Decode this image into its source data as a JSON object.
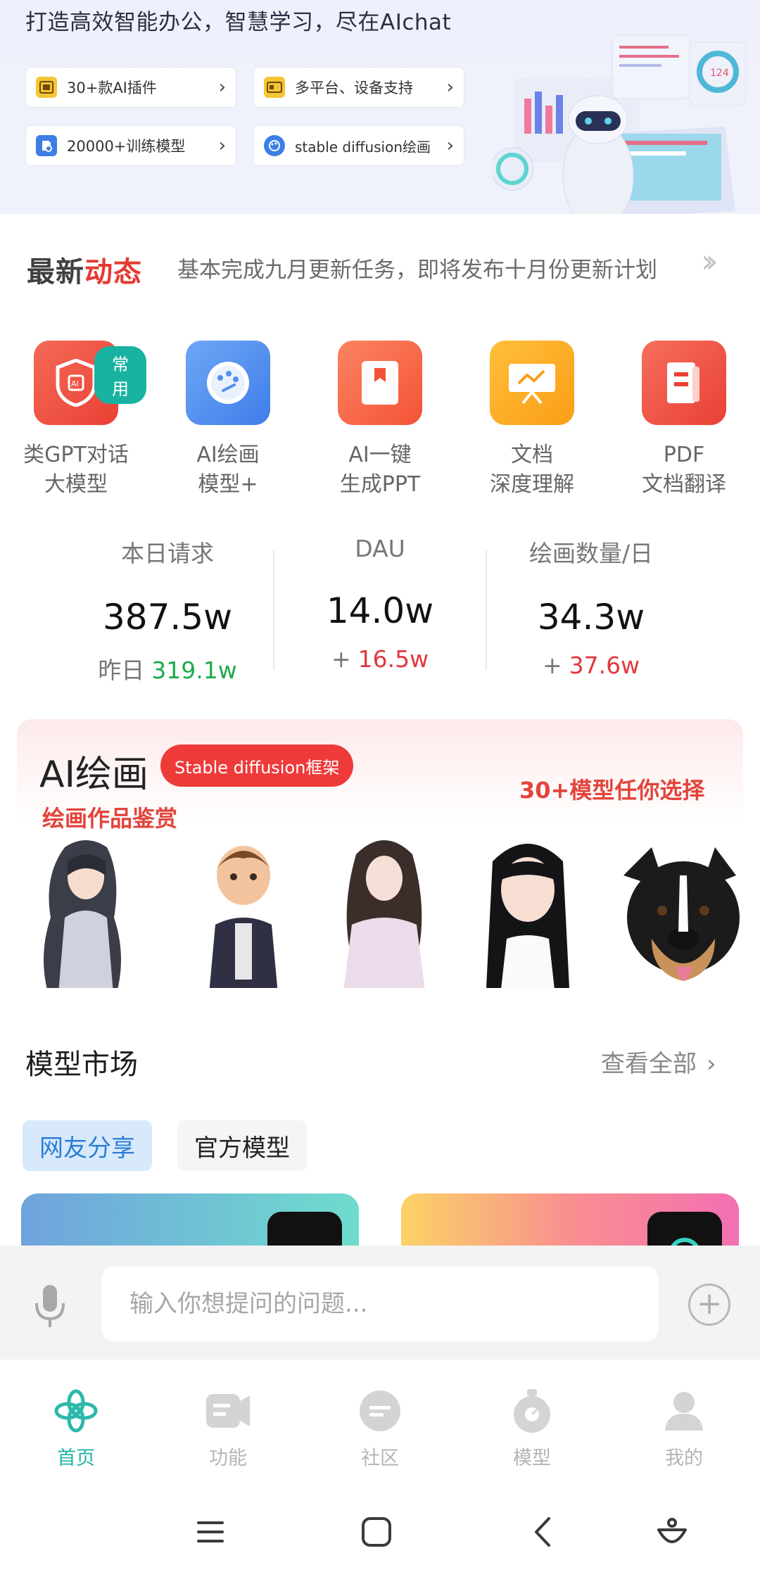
{
  "hero": {
    "title": "打造高效智能办公，智慧学习，尽在AIchat",
    "features": [
      {
        "label": "30+款AI插件",
        "icon": "plugin-icon"
      },
      {
        "label": "多平台、设备支持",
        "icon": "devices-icon"
      },
      {
        "label": "20000+训练模型",
        "icon": "model-train-icon"
      },
      {
        "label": "stable diffusion绘画",
        "icon": "paint-icon"
      }
    ]
  },
  "news": {
    "label_part1": "最新",
    "label_part2": "动态",
    "text": "基本完成九月更新任务，即将发布十月份更新计划"
  },
  "apps": [
    {
      "line1": "类GPT对话",
      "line2": "大模型",
      "badge": "常用",
      "color": "#f0574a"
    },
    {
      "line1": "AI绘画",
      "line2": "模型+",
      "color": "#4f8ff0"
    },
    {
      "line1": "AI一键",
      "line2": "生成PPT",
      "color": "#f86a4a"
    },
    {
      "line1": "文档",
      "line2": "深度理解",
      "color": "#fca825"
    },
    {
      "line1": "PDF",
      "line2": "文档翻译",
      "color": "#ef4d42"
    }
  ],
  "stats": [
    {
      "label": "本日请求",
      "value": "387.5w",
      "sub_prefix": "昨日",
      "sub_value": "319.1w",
      "trend": "green"
    },
    {
      "label": "DAU",
      "value": "14.0w",
      "sub_prefix": "+",
      "sub_value": "16.5w",
      "trend": "red"
    },
    {
      "label": "绘画数量/日",
      "value": "34.3w",
      "sub_prefix": "+",
      "sub_value": "37.6w",
      "trend": "red"
    }
  ],
  "painting": {
    "title": "AI绘画",
    "tag": "Stable diffusion框架",
    "subtitle": "绘画作品鉴赏",
    "right_text": "30+模型任你选择"
  },
  "market": {
    "title": "模型市场",
    "view_all": "查看全部",
    "tabs": [
      "网友分享",
      "官方模型"
    ]
  },
  "input": {
    "placeholder": "输入你想提问的问题..."
  },
  "nav": [
    {
      "label": "首页",
      "active": true
    },
    {
      "label": "功能",
      "active": false
    },
    {
      "label": "社区",
      "active": false
    },
    {
      "label": "模型",
      "active": false
    },
    {
      "label": "我的",
      "active": false
    }
  ],
  "colors": {
    "accent": "#20b4a6",
    "red": "#e0383e",
    "green": "#1faa4a",
    "tab_active_bg": "#d8e9fb",
    "tab_active_text": "#2a7ed8"
  }
}
